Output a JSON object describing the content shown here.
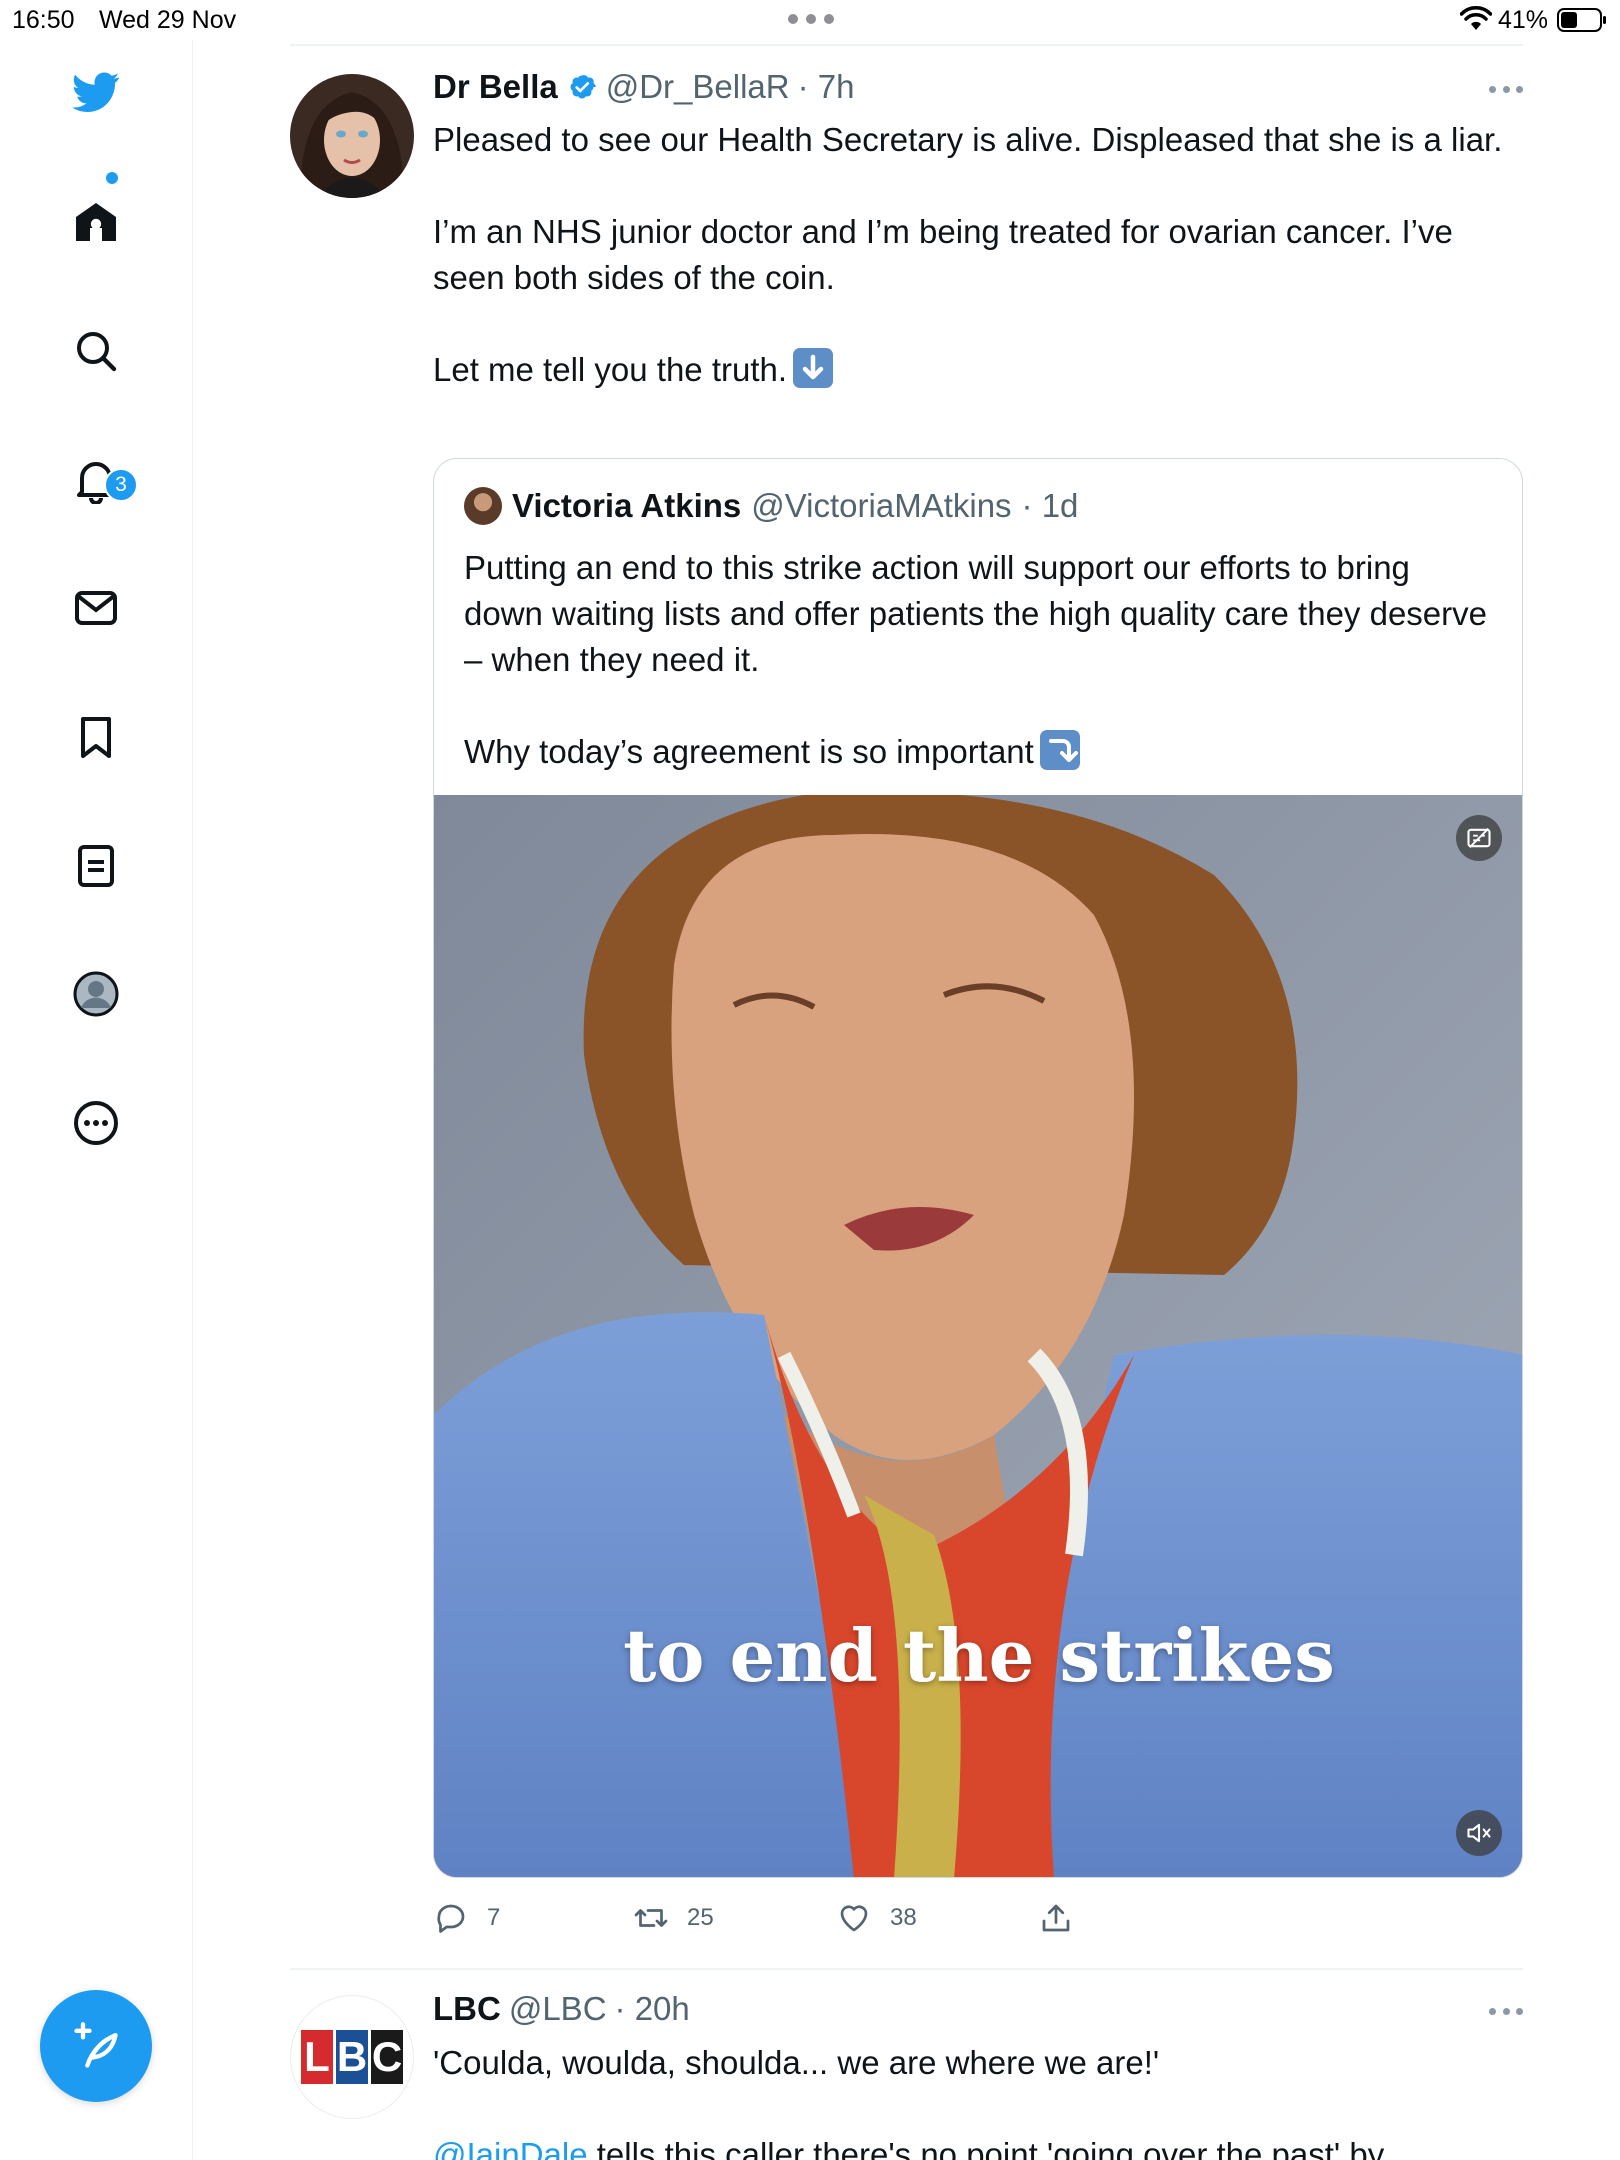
{
  "status_bar": {
    "time": "16:50",
    "date": "Wed 29 Nov",
    "battery": "41%"
  },
  "colors": {
    "accent": "#1d9bf0",
    "text": "#0f1419",
    "muted": "#536471",
    "border": "#cfd9de"
  },
  "sidebar": {
    "items": [
      {
        "name": "twitter-logo-icon"
      },
      {
        "name": "home-icon"
      },
      {
        "name": "search-icon"
      },
      {
        "name": "notifications-icon",
        "badge": "3"
      },
      {
        "name": "messages-icon"
      },
      {
        "name": "bookmarks-icon"
      },
      {
        "name": "lists-icon"
      },
      {
        "name": "profile-icon"
      },
      {
        "name": "more-icon"
      }
    ],
    "compose": "compose-icon"
  },
  "tweet1": {
    "name": "Dr Bella",
    "handle": "@Dr_BellaR",
    "time": "· 7h",
    "para1": "Pleased to see our Health Secretary is alive. Displeased that she is a liar.",
    "para2": "I’m an NHS junior doctor and I’m being treated for ovarian cancer. I’ve seen both sides of the coin.",
    "para3": "Let me tell you the truth.",
    "para3_emoji": "down-arrow-emoji",
    "quote": {
      "name": "Victoria Atkins",
      "handle": "@VictoriaMAtkins",
      "time": "· 1d",
      "para1": "Putting an end to this strike action will support our efforts to bring down waiting lists and offer patients the high quality care they deserve – when they need it.",
      "para2": "Why today’s agreement is so important",
      "para2_emoji": "arrow-down-right-emoji",
      "video_caption": "to end the strikes"
    },
    "replies": "7",
    "retweets": "25",
    "likes": "38"
  },
  "tweet2": {
    "name": "LBC",
    "handle": "@LBC",
    "time": "· 20h",
    "line1": "'Coulda, woulda, shoulda... we are where we are!'",
    "mention": "@IainDale",
    "line2_rest": " tells this caller there's no point 'going over the past' by"
  }
}
